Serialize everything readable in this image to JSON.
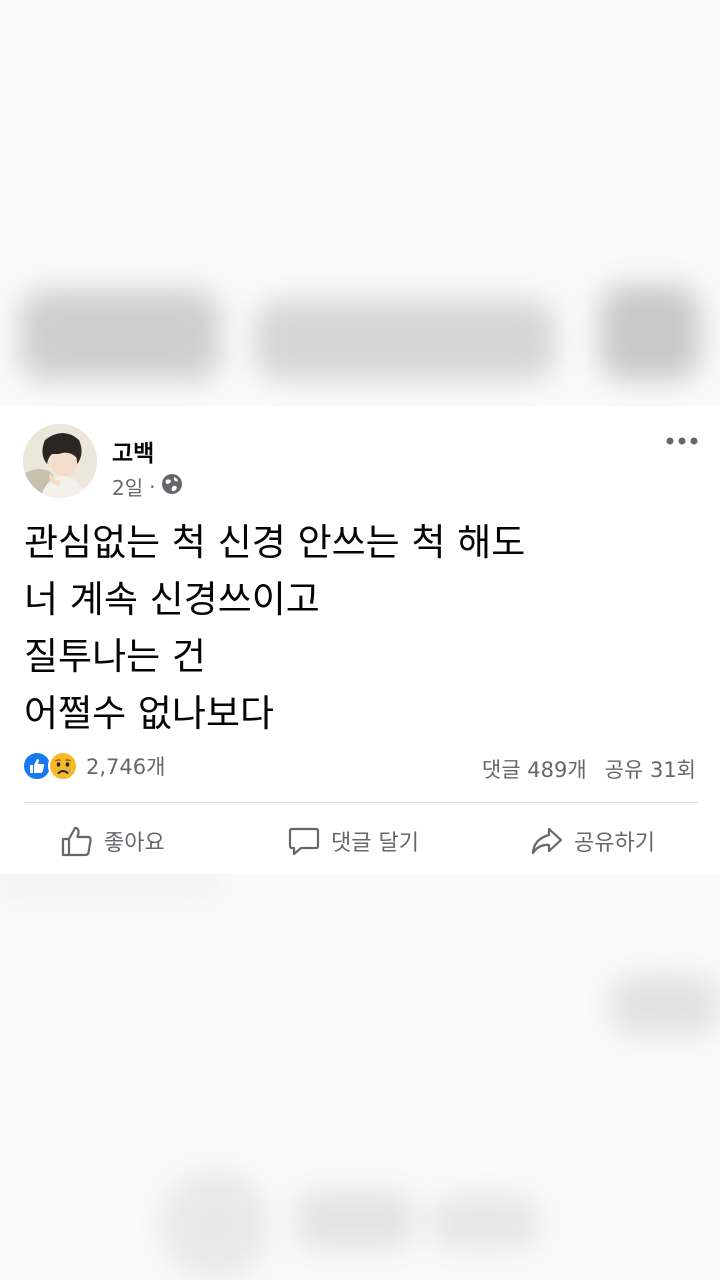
{
  "post": {
    "author": "고백",
    "time": "2일",
    "separator": "·",
    "privacy_icon": "globe-icon",
    "text": "관심없는 척 신경 안쓰는 척 해도\n너 계속 신경쓰이고\n질투나는 건\n어쩔수 없나보다",
    "reactions": {
      "icons": [
        "like-icon",
        "sad-icon"
      ],
      "count": "2,746개"
    },
    "comments_count": "댓글 489개",
    "shares_count": "공유 31회",
    "actions": {
      "like": "좋아요",
      "comment": "댓글 달기",
      "share": "공유하기"
    }
  },
  "colors": {
    "like_blue": "#1877f2",
    "sad_yellow": "#f7b928",
    "secondary_text": "#65676b"
  }
}
